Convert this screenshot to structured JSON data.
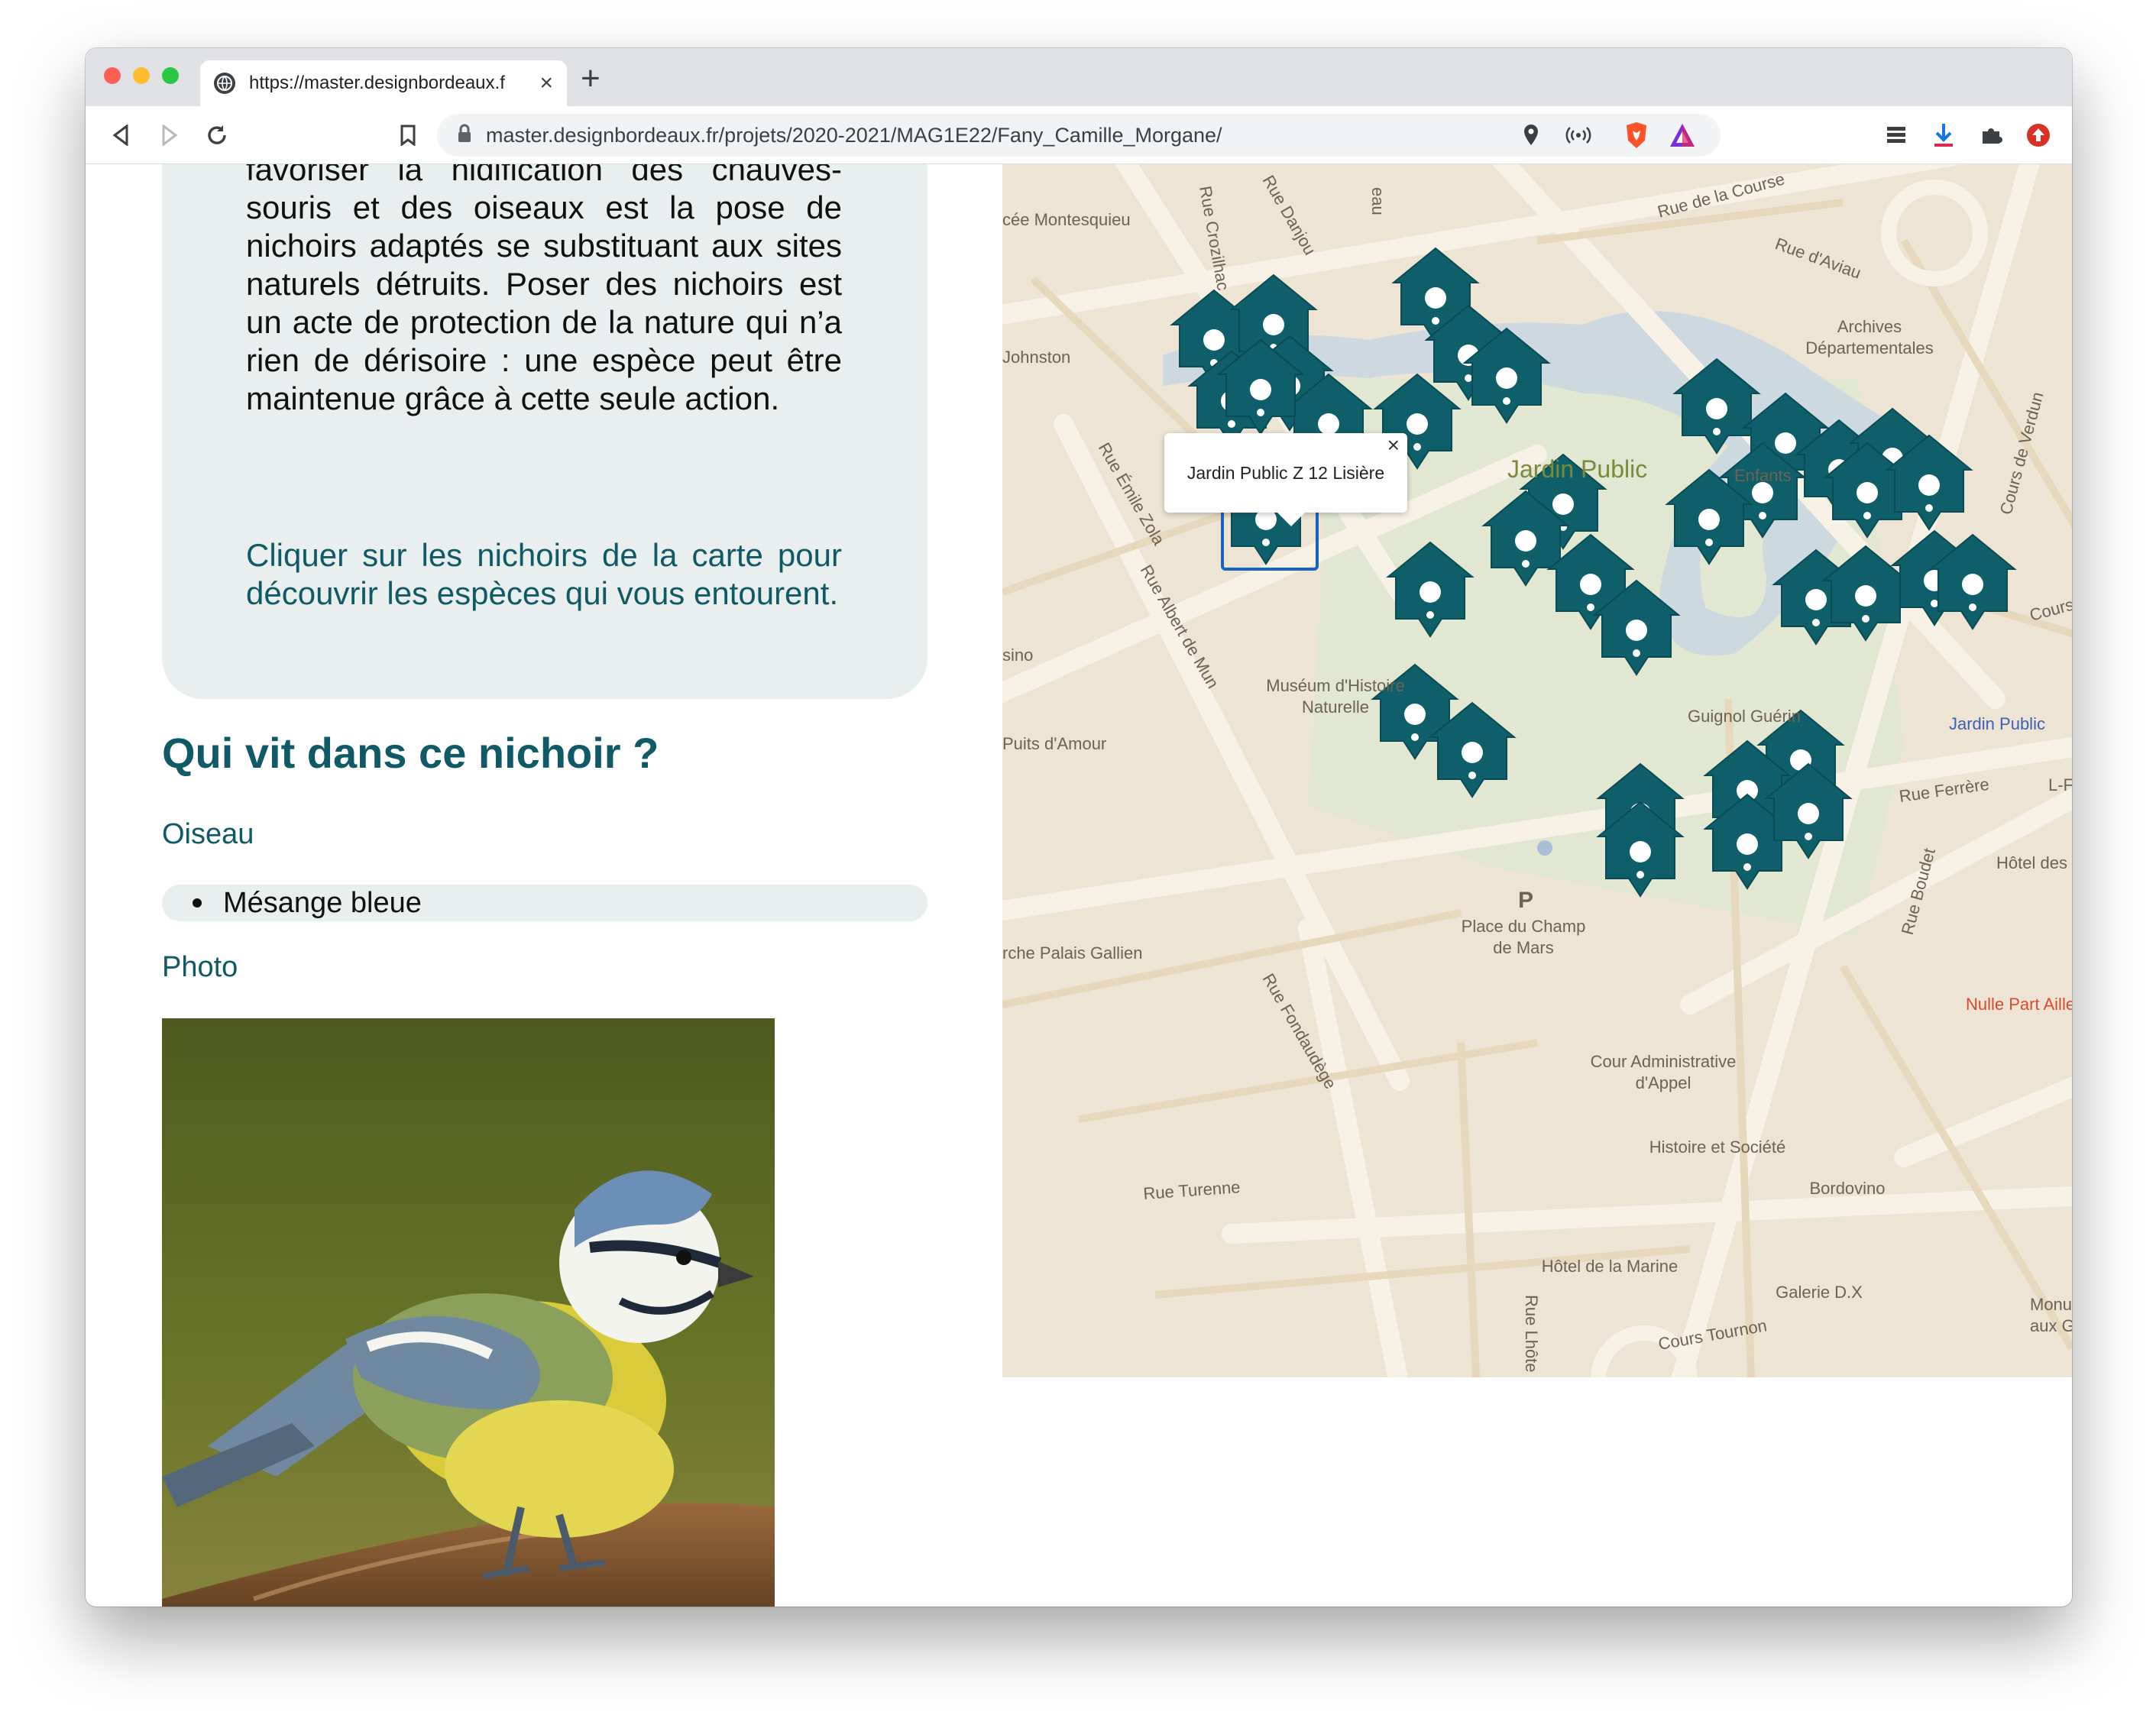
{
  "browser": {
    "tab_title": "https://master.designbordeaux.f",
    "tab_close": "×",
    "new_tab": "+",
    "url": "master.designbordeaux.fr/projets/2020-2021/MAG1E22/Fany_Camille_Morgane/"
  },
  "intro": {
    "paragraph": "favoriser la nidification des chauves-souris et des oiseaux est la pose de nichoirs adaptés se substituant aux sites naturels détruits. Poser des nichoirs est un acte de protection de la nature qui n’a rien de dérisoire : une espèce peut être maintenue grâce à cette seule action.",
    "call_to_action": "Cliquer sur les nichoirs de la carte pour découvrir les espèces qui vous entourent."
  },
  "section": {
    "title": "Qui vit dans ce nichoir ?",
    "bird_label": "Oiseau",
    "birds": [
      "Mésange bleue"
    ],
    "photo_label": "Photo"
  },
  "map": {
    "popup_text": "Jardin Public Z 12 Lisière",
    "popup_close": "×",
    "marker_color": "#0f5f6b",
    "labels": {
      "montesquieu": "cée Montesquieu",
      "crozilhac": "Rue Crozilhac",
      "danjou": "Rue Danjou",
      "eau": "eau",
      "course": "Rue de la Course",
      "aviau": "Rue d'Aviau",
      "archives": "Archives\nDépartementales",
      "johnston": "Johnston",
      "emile": "Rue Émile Zola",
      "verdun": "Cours de Verdun",
      "jardin": "Jardin Public",
      "enfants": "Enfants",
      "albert": "Rue Albert de Mun",
      "casino": "sino",
      "museum": "Muséum d'Histoire\nNaturelle",
      "guignol": "Guignol Guérin",
      "cours": "Cours",
      "jardin_public_poi": "Jardin Public",
      "puits": "Puits d'Amour",
      "ferrere": "Rue Ferrère",
      "lfi": "L-Fi",
      "boudet": "Rue Boudet",
      "hotel_qui": "Hôtel des Qui",
      "champ": "Place du Champ\nde Mars",
      "parking": "P",
      "palais": "rche Palais Gallien",
      "fondaudege": "Rue Fondaudège",
      "nulle": "Nulle Part Ailleurs",
      "cour_admin": "Cour Administrative\nd'Appel",
      "histoire": "Histoire et Société",
      "bordovino": "Bordovino",
      "turenne": "Rue Turenne",
      "marine": "Hôtel de la Marine",
      "galerie": "Galerie D.X",
      "monu": "Monu\naux Gir",
      "tournon": "Cours Tournon",
      "lhote": "Rue Lhôte"
    }
  }
}
